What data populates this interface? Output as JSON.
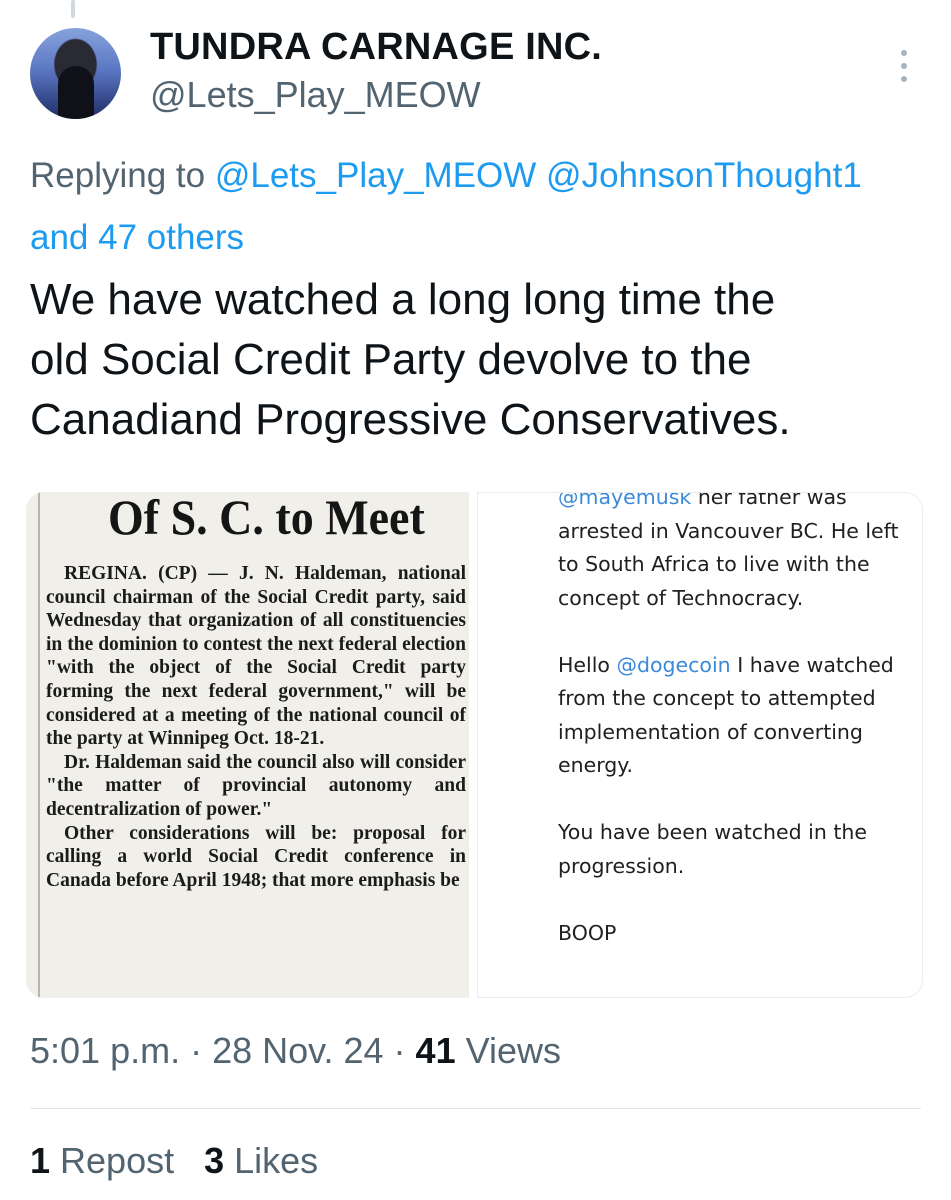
{
  "author": {
    "display_name": "TUNDRA CARNAGE INC.",
    "handle": "@Lets_Play_MEOW",
    "avatar_icon": "hooded-figure-avatar"
  },
  "reply": {
    "prefix": "Replying to",
    "mention_1": "@Lets_Play_MEOW",
    "mention_2": "@JohnsonThought1",
    "others": "and 47 others"
  },
  "tweet": {
    "text": "We have watched a long long time the\nold Social Credit Party devolve to the\nCanadiand Progressive Conservatives."
  },
  "media": {
    "newspaper_clip": {
      "headline": "Of S. C. to Meet",
      "paragraphs": [
        "REGINA. (CP) — J. N. Haldeman, national council chairman of the Social Credit party, said Wednesday that organization of all constituencies in the dominion to contest the next federal election \"with the object of the Social Credit party forming the next federal government,\" will be considered at a meeting of the national council of the party at Winnipeg Oct. 18-21.",
        "Dr. Haldeman said the council also will consider \"the matter of provincial autonomy and decentralization of power.\"",
        "Other considerations will be: proposal for calling a world Social Credit conference in Canada before April 1948; that more emphasis be"
      ]
    },
    "screenshot_clip": {
      "p1_link": "@mayemusk",
      "p1_text": " her father was arrested in Vancouver BC. He left to South Africa to live with the concept of Technocracy.",
      "p2_prefix": "Hello ",
      "p2_link": "@dogecoin",
      "p2_text": " I have watched from the concept to attempted implementation of converting energy.",
      "p3_text": "You have been watched in the progression.",
      "p4_text": "BOOP"
    }
  },
  "meta": {
    "time": "5:01 p.m.",
    "sep1": " · ",
    "date": "28 Nov. 24",
    "sep2": " · ",
    "views_count": "41",
    "views_label": " Views"
  },
  "stats": {
    "reposts_count": "1",
    "reposts_label": " Repost",
    "likes_count": "3",
    "likes_label": " Likes"
  },
  "colors": {
    "link": "#1d9bf0",
    "secondary_text": "#536471",
    "primary_text": "#0f1419"
  }
}
